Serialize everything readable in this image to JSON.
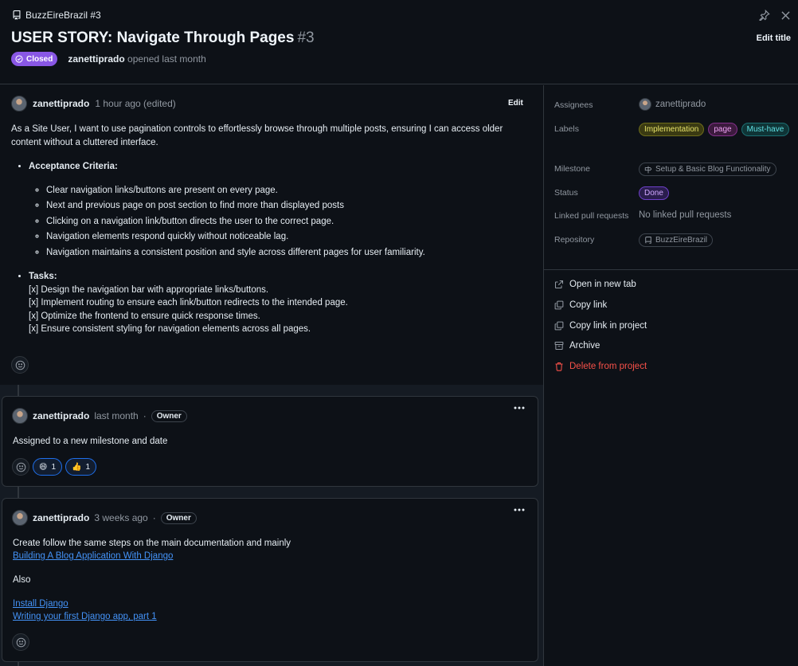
{
  "header": {
    "repo": "BuzzEireBrazil #3",
    "title": "USER STORY: Navigate Through Pages",
    "number": "#3",
    "edit_title": "Edit title",
    "state": "Closed",
    "opener": "zanettiprado",
    "opened_text": "opened last month"
  },
  "issue_body": {
    "author": "zanettiprado",
    "time": "1 hour ago (edited)",
    "edit_label": "Edit",
    "intro": "As a Site User, I want to use pagination controls to effortlessly browse through multiple posts, ensuring I can access older content without a cluttered interface.",
    "acceptance_title": "Acceptance Criteria:",
    "acceptance": [
      "Clear navigation links/buttons are present on every page.",
      "Next and previous page on post section to find more than displayed posts",
      "Clicking on a navigation link/button directs the user to the correct page.",
      "Navigation elements respond quickly without noticeable lag.",
      "Navigation maintains a consistent position and style across different pages for user familiarity."
    ],
    "tasks_title": "Tasks:",
    "tasks": [
      "[x] Design the navigation bar with appropriate links/buttons.",
      "[x] Implement routing to ensure each link/button redirects to the intended page.",
      "[x] Optimize the frontend to ensure quick response times.",
      "[x] Ensure consistent styling for navigation elements across all pages."
    ]
  },
  "comments": [
    {
      "author": "zanettiprado",
      "time": "last month",
      "role": "Owner",
      "text": "Assigned to a new milestone and date",
      "reactions": [
        {
          "emoji": "😄",
          "count": "1"
        },
        {
          "emoji": "👍",
          "count": "1"
        }
      ]
    },
    {
      "author": "zanettiprado",
      "time": "3 weeks ago",
      "role": "Owner",
      "line1": "Create follow the same steps on the main documentation and mainly",
      "link1": "Building A Blog Application With Django",
      "also": "Also",
      "link2": "Install Django",
      "link3": "Writing your first Django app, part 1"
    }
  ],
  "sidebar": {
    "assignees_label": "Assignees",
    "assignee": "zanettiprado",
    "labels_label": "Labels",
    "labels": [
      "Implementation",
      "page",
      "Must-have"
    ],
    "milestone_label": "Milestone",
    "milestone": "Setup & Basic Blog Functionality",
    "status_label": "Status",
    "status": "Done",
    "linked_label": "Linked pull requests",
    "linked_value": "No linked pull requests",
    "repo_label": "Repository",
    "repo": "BuzzEireBrazil",
    "actions": [
      "Open in new tab",
      "Copy link",
      "Copy link in project",
      "Archive",
      "Delete from project"
    ]
  },
  "colors": {
    "background": "#0d1117",
    "closed_badge": "#8957e5",
    "link": "#4493f8",
    "danger": "#f85149"
  }
}
